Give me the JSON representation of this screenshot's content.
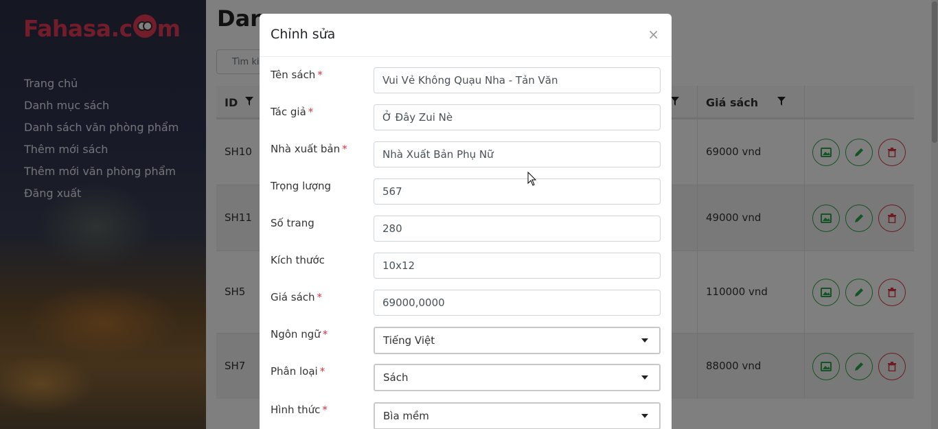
{
  "sidebar": {
    "logo": {
      "prefix": "Fahasa.c",
      "suffix": "m"
    },
    "nav": [
      "Trang chủ",
      "Danh mục sách",
      "Danh sách văn phòng phẩm",
      "Thêm mới sách",
      "Thêm mới văn phòng phẩm",
      "Đăng xuất"
    ]
  },
  "page": {
    "title": "Dan",
    "search_placeholder": "Tìm ki",
    "table": {
      "headers": {
        "id": "ID",
        "price": "Giá sách"
      },
      "rows": [
        {
          "id": "SH10",
          "price": "69000 vnd"
        },
        {
          "id": "SH11",
          "price": "49000 vnd"
        },
        {
          "id": "SH5",
          "price": "110000 vnd"
        },
        {
          "id": "SH7",
          "price": "88000 vnd"
        }
      ]
    }
  },
  "modal": {
    "title": "Chỉnh sửa",
    "close": "×",
    "fields": [
      {
        "label": "Tên sách",
        "required": "*",
        "value": "Vui Vẻ Không Quạu Nha - Tản Văn"
      },
      {
        "label": "Tác giả",
        "required": "*",
        "value": "Ở Đây Zui Nè"
      },
      {
        "label": "Nhà xuất bản",
        "required": "*",
        "value": "Nhà Xuất Bản Phụ Nữ"
      },
      {
        "label": "Trọng lượng",
        "required": "",
        "value": "567"
      },
      {
        "label": "Số trang",
        "required": "",
        "value": "280"
      },
      {
        "label": "Kích thước",
        "required": "",
        "value": "10x12"
      },
      {
        "label": "Giá sách",
        "required": "*",
        "value": "69000,0000"
      }
    ],
    "selects": [
      {
        "label": "Ngôn ngữ",
        "required": "*",
        "value": "Tiếng Việt"
      },
      {
        "label": "Phân loại",
        "required": "*",
        "value": "Sách"
      },
      {
        "label": "Hình thức",
        "required": "*",
        "value": "Bìa mềm"
      }
    ]
  },
  "colors": {
    "brand": "#e63a57",
    "success": "#28a745",
    "danger": "#dc3545"
  }
}
